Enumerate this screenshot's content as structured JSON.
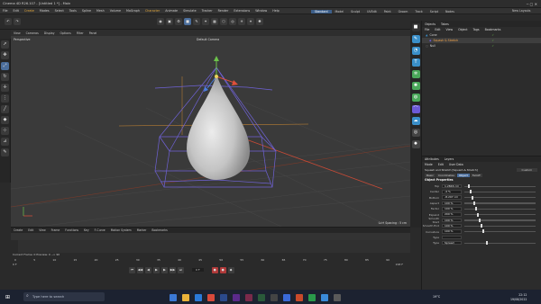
{
  "window": {
    "title": "Cinema 4D R26.107 - [Untitled 1 *] - Main"
  },
  "menubar": {
    "items": [
      "File",
      "Edit",
      "Create",
      "Modes",
      "Select",
      "Tools",
      "Spline",
      "Mesh",
      "Volume",
      "MoGraph",
      "Character",
      "Animate",
      "Simulate",
      "Tracker",
      "Render",
      "Extensions",
      "Window",
      "Help"
    ],
    "workspaces": [
      "Standard",
      "Model",
      "Sculpt",
      "UVEdit",
      "Paint",
      "Groom",
      "Track",
      "Script",
      "Nodes"
    ],
    "active_workspace": "Standard",
    "new_layouts": "New Layouts"
  },
  "viewport": {
    "menu": [
      "View",
      "Cameras",
      "Display",
      "Options",
      "Filter",
      "Panel"
    ],
    "name": "Perspective",
    "camera": "Default Camera",
    "grid_spacing": "Grid Spacing : 5 cm"
  },
  "object_manager": {
    "tabs": [
      "Objects",
      "Takes"
    ],
    "menu": [
      "File",
      "Edit",
      "View",
      "Object",
      "Tags",
      "Bookmarks"
    ],
    "objects": [
      {
        "name": "Cone",
        "selected": false
      },
      {
        "name": "Squash & Stretch",
        "selected": true
      },
      {
        "name": "Null",
        "selected": false
      }
    ]
  },
  "attribute_manager": {
    "tabs": [
      "Attributes",
      "Layers"
    ],
    "menu": [
      "Mode",
      "Edit",
      "User Data"
    ],
    "object_title": "Squash and Stretch [Squash & Stretch]",
    "mode": "Custom",
    "sub_tabs": [
      "Basic",
      "Coordinates",
      "Object",
      "Falloff"
    ],
    "active_sub_tab": "Object",
    "section": "Object Properties",
    "params": [
      {
        "label": "Top",
        "value": "1.2846 cm",
        "fill": 0.0
      },
      {
        "label": "Center",
        "value": "-4 %",
        "fill": 0.0
      },
      {
        "label": "Bottom",
        "value": "-8.207 cm",
        "fill": 0.0
      },
      {
        "label": "Aspect",
        "value": "100 %",
        "fill": 0.0
      },
      {
        "label": "Factor",
        "value": "100 %",
        "fill": 0.0
      },
      {
        "label": "Expand",
        "value": "200 %",
        "fill": 0.0
      },
      {
        "label": "Smooth Start",
        "value": "100 %",
        "fill": 0.0
      },
      {
        "label": "Smooth End",
        "value": "100 %",
        "fill": 0.0
      },
      {
        "label": "Curvature",
        "value": "100 %",
        "fill": 0.0
      },
      {
        "label": "Type",
        "value": "",
        "fill": 0.0
      },
      {
        "label": "Type",
        "value": "Spread",
        "fill": 0.0
      }
    ]
  },
  "timeline": {
    "menu": [
      "Create",
      "Edit",
      "View",
      "Frame",
      "Functions",
      "Key",
      "F-Curve",
      "Motion System",
      "Marker",
      "Bookmarks"
    ],
    "current_frame_label": "Current Frame: 0  Preview: 0 --> 90",
    "start": "0 F",
    "end": "90 F",
    "current_frame": "0 F",
    "fps_end": "218 F",
    "ruler": [
      "0",
      "5",
      "10",
      "15",
      "20",
      "25",
      "30",
      "35",
      "40",
      "45",
      "50",
      "55",
      "60",
      "65",
      "70",
      "75",
      "80",
      "85",
      "90"
    ]
  },
  "taskbar": {
    "search_placeholder": "Type here to search",
    "temperature": "19°C",
    "time": "22:12",
    "date": "19/08/2022"
  },
  "colors": {
    "axis_x": "#e0503b",
    "axis_y": "#6cc24a",
    "axis_z": "#4a7ee0",
    "deformer_cage": "#6f62d6",
    "selected_object": "#f3a44a",
    "active_workspace": "#3d5f8a"
  }
}
